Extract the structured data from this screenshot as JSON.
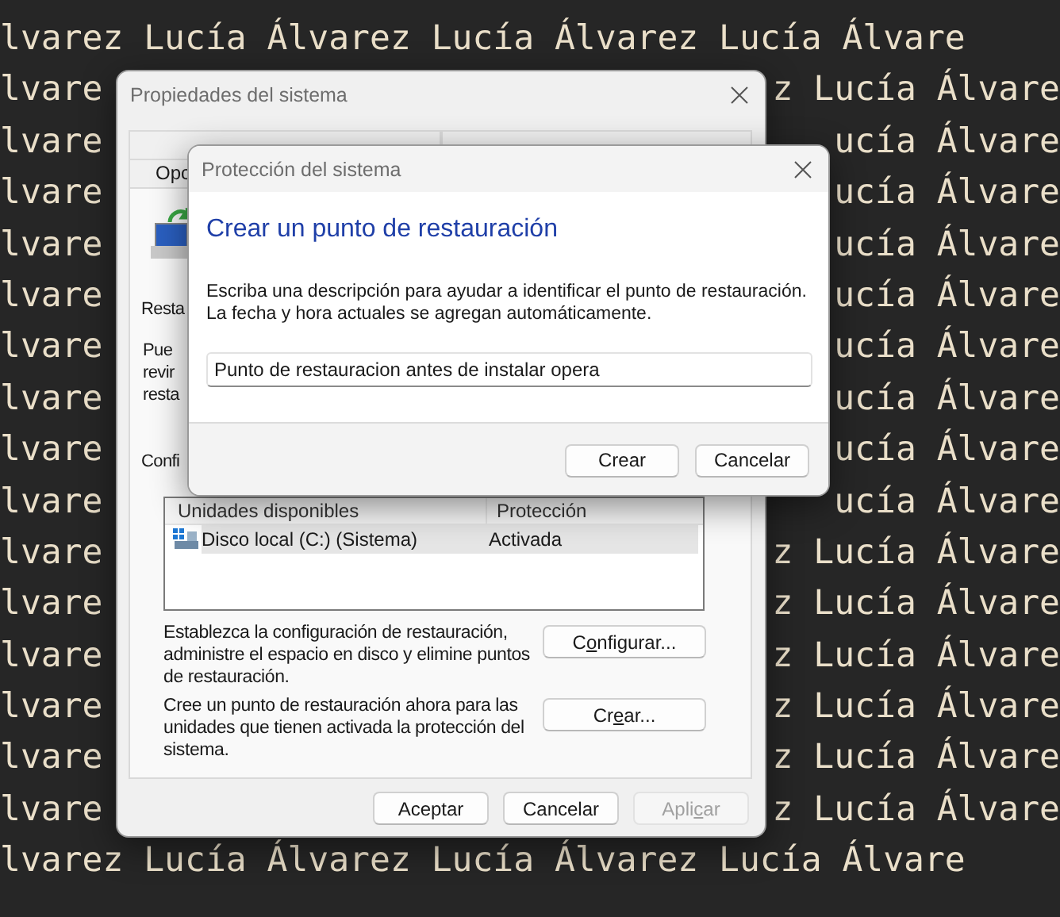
{
  "desktop_lines": [
    {
      "segments": [
        "lvarez Lucía Álvarez Lucía Álvarez Lucía Álvare"
      ]
    },
    {
      "segments": [
        "lvare",
        "z Lucía Álvare"
      ]
    },
    {
      "segments": [
        "lvare",
        "ucía Álvare"
      ]
    },
    {
      "segments": [
        "lvare",
        "ucía Álvare"
      ]
    },
    {
      "segments": [
        "lvare",
        "ucía Álvare"
      ]
    },
    {
      "segments": [
        "lvare",
        "ucía Álvare"
      ]
    },
    {
      "segments": [
        "lvare",
        "ucía Álvare"
      ]
    },
    {
      "segments": [
        "lvare",
        "ucía Álvare"
      ]
    },
    {
      "segments": [
        "lvare",
        "ucía Álvare"
      ]
    },
    {
      "segments": [
        "lvare",
        "ucía Álvare"
      ]
    },
    {
      "segments": [
        "lvare",
        "z Lucía Álvare"
      ]
    },
    {
      "segments": [
        "lvare",
        "z Lucía Álvare"
      ]
    },
    {
      "segments": [
        "lvare",
        "z Lucía Álvare"
      ]
    },
    {
      "segments": [
        "lvare",
        "z Lucía Álvare"
      ]
    },
    {
      "segments": [
        "lvare",
        "z Lucía Álvare"
      ]
    },
    {
      "segments": [
        "lvare",
        "z Lucía Álvare"
      ]
    },
    {
      "segments": [
        "lvarez Lucía Álvarez Lucía Álvarez Lucía Álvare"
      ]
    }
  ],
  "system_properties": {
    "title": "Propiedades del sistema",
    "tab": "Opc",
    "section_label": "Resta",
    "description_lines": [
      "Pue",
      "revir",
      "resta"
    ],
    "config_label": "Confi",
    "drives_table": {
      "columns": [
        "Unidades disponibles",
        "Protección"
      ],
      "rows": [
        {
          "drive": "Disco local (C:) (Sistema)",
          "protection": "Activada",
          "selected": true
        }
      ]
    },
    "actions": [
      {
        "text": "Establezca la configuración de restauración, administre el espacio en disco y elimine puntos de restauración.",
        "button": {
          "label": {
            "before": "C",
            "access_key": "o",
            "after": "nfigurar..."
          }
        }
      },
      {
        "text": "Cree un punto de restauración ahora para las unidades que tienen activada la protección del sistema.",
        "button": {
          "label": {
            "before": "Cr",
            "access_key": "e",
            "after": "ar..."
          }
        }
      }
    ],
    "buttons": [
      {
        "label": {
          "before": "Aceptar"
        },
        "disabled": false
      },
      {
        "label": {
          "before": "Cancelar"
        },
        "disabled": false
      },
      {
        "label": {
          "before": "Apli",
          "access_key": "c",
          "after": "ar"
        },
        "disabled": true
      }
    ]
  },
  "dialog": {
    "title": "Protección del sistema",
    "heading": "Crear un punto de restauración",
    "instructions": "Escriba una descripción para ayudar a identificar el punto de restauración. La fecha y hora actuales se agregan automáticamente.",
    "description_field": {
      "value": "Punto de restauracion antes de instalar opera"
    },
    "buttons": [
      {
        "label": "Crear"
      },
      {
        "label": "Cancelar"
      }
    ]
  }
}
